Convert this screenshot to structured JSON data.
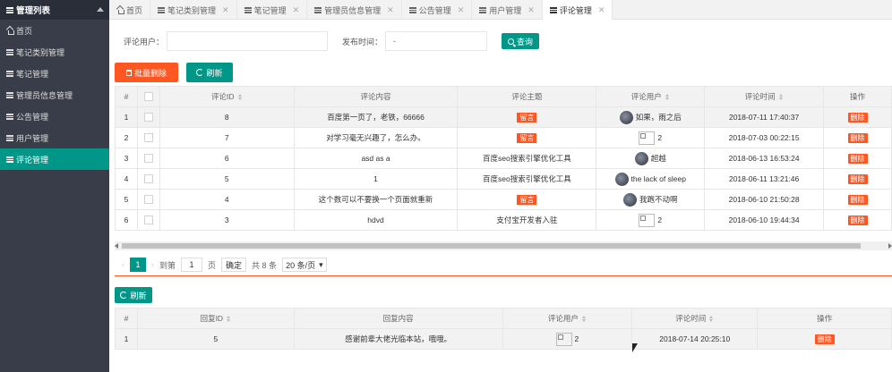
{
  "sidebar": {
    "title": "管理列表",
    "items": [
      {
        "label": "首页",
        "icon": "home-icon"
      },
      {
        "label": "笔记类别管理",
        "icon": "list-icon"
      },
      {
        "label": "笔记管理",
        "icon": "list-icon"
      },
      {
        "label": "管理员信息管理",
        "icon": "list-icon"
      },
      {
        "label": "公告管理",
        "icon": "list-icon"
      },
      {
        "label": "用户管理",
        "icon": "list-icon"
      },
      {
        "label": "评论管理",
        "icon": "list-icon",
        "active": true
      }
    ]
  },
  "tabs": [
    {
      "label": "首页"
    },
    {
      "label": "笔记类别管理"
    },
    {
      "label": "笔记管理"
    },
    {
      "label": "管理员信息管理"
    },
    {
      "label": "公告管理"
    },
    {
      "label": "用户管理"
    },
    {
      "label": "评论管理",
      "active": true
    }
  ],
  "search": {
    "user_label": "评论用户：",
    "user_value": "",
    "time_label": "发布时间：",
    "time_value": "-",
    "query_label": "查询"
  },
  "toolbar": {
    "batch_delete": "批量删除",
    "refresh": "刷新"
  },
  "comments_table": {
    "headers": [
      "#",
      "评论ID",
      "评论内容",
      "评论主题",
      "评论用户",
      "评论时间",
      "操作"
    ],
    "rows": [
      {
        "idx": "1",
        "id": "8",
        "content": "百度第一页了，老铁，66666",
        "topic": "留言",
        "topic_tag": true,
        "user": "如果，雨之后",
        "avatar": "photo",
        "time": "2018-07-11 17:40:37",
        "action": "删除"
      },
      {
        "idx": "2",
        "id": "7",
        "content": "对学习毫无兴趣了，怎么办。",
        "topic": "留言",
        "topic_tag": true,
        "user": "2",
        "avatar": "broken",
        "time": "2018-07-03 00:22:15",
        "action": "删除"
      },
      {
        "idx": "3",
        "id": "6",
        "content": "asd as a",
        "topic": "百度seo搜索引擎优化工具",
        "topic_tag": false,
        "user": "超越",
        "avatar": "photo",
        "time": "2018-06-13 16:53:24",
        "action": "删除"
      },
      {
        "idx": "4",
        "id": "5",
        "content": "1",
        "topic": "百度seo搜索引擎优化工具",
        "topic_tag": false,
        "user": "the lack of sleep",
        "avatar": "photo",
        "time": "2018-06-11 13:21:46",
        "action": "删除"
      },
      {
        "idx": "5",
        "id": "4",
        "content": "这个数可以不要换一个页面就重新",
        "topic": "留言",
        "topic_tag": true,
        "user": "我跑不动啊",
        "avatar": "photo",
        "time": "2018-06-10 21:50:28",
        "action": "删除"
      },
      {
        "idx": "6",
        "id": "3",
        "content": "hdvd",
        "topic": "支付宝开发者入驻",
        "topic_tag": false,
        "user": "2",
        "avatar": "broken",
        "time": "2018-06-10 19:44:34",
        "action": "删除"
      }
    ]
  },
  "pager": {
    "current": "1",
    "goto_label": "到第",
    "goto_value": "1",
    "page_label": "页",
    "confirm": "确定",
    "total": "共 8 条",
    "page_size": "20 条/页"
  },
  "reply_toolbar": {
    "refresh": "刷新"
  },
  "replies_table": {
    "headers": [
      "#",
      "回复ID",
      "回复内容",
      "评论用户",
      "评论时间",
      "操作"
    ],
    "rows": [
      {
        "idx": "1",
        "id": "5",
        "content": "感谢前辈大佬光临本站，哦哦。",
        "user": "2",
        "time": "2018-07-14 20:25:10",
        "action": "删除"
      }
    ]
  }
}
